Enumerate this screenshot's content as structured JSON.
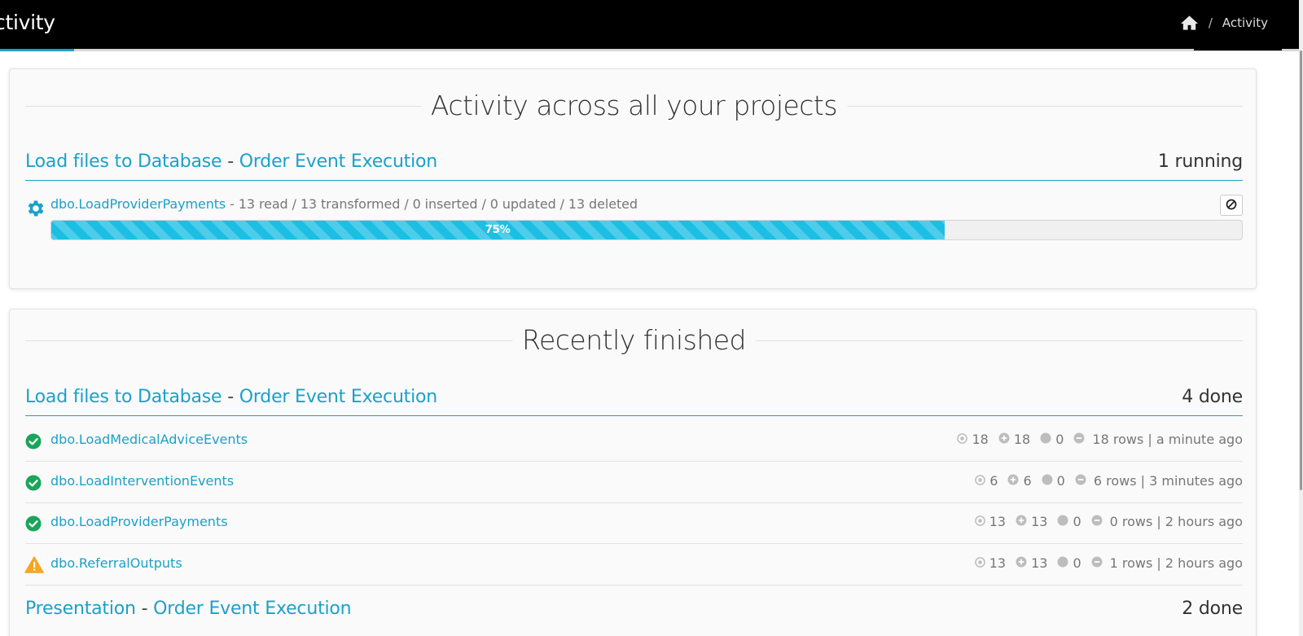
{
  "header": {
    "title": "ctivity",
    "breadcrumb": {
      "home_icon": "home-icon",
      "separator": "/",
      "current": "Activity"
    }
  },
  "colors": {
    "accent": "#1ba1c8",
    "success": "#1aa55a",
    "warning": "#f5a623",
    "header_bg": "#000000",
    "progress": "#1bbfe3"
  },
  "running": {
    "title": "Activity across all your projects",
    "group": {
      "project": "Load files to Database",
      "dash": "-",
      "execution": "Order Event Execution",
      "count": "1 running"
    },
    "job": {
      "name": "dbo.LoadProviderPayments",
      "detail": "- 13 read / 13 transformed / 0 inserted / 0 updated / 13 deleted",
      "progress_percent": 75,
      "progress_label": "75%",
      "cancel_icon": "cancel-icon"
    }
  },
  "finished": {
    "title": "Recently finished",
    "groups": [
      {
        "project": "Load files to Database",
        "dash": "-",
        "execution": "Order Event Execution",
        "count": "4 done",
        "jobs": [
          {
            "name": "dbo.LoadMedicalAdviceEvents",
            "status": "success",
            "read": "18",
            "added": "18",
            "zero": "0",
            "rows": "18 rows | a minute ago"
          },
          {
            "name": "dbo.LoadInterventionEvents",
            "status": "success",
            "read": "6",
            "added": "6",
            "zero": "0",
            "rows": "6 rows | 3 minutes ago"
          },
          {
            "name": "dbo.LoadProviderPayments",
            "status": "success",
            "read": "13",
            "added": "13",
            "zero": "0",
            "rows": "0 rows | 2 hours ago"
          },
          {
            "name": "dbo.ReferralOutputs",
            "status": "warning",
            "read": "13",
            "added": "13",
            "zero": "0",
            "rows": "1 rows | 2 hours ago"
          }
        ]
      },
      {
        "project": "Presentation",
        "dash": "-",
        "execution": "Order Event Execution",
        "count": "2 done"
      }
    ]
  }
}
